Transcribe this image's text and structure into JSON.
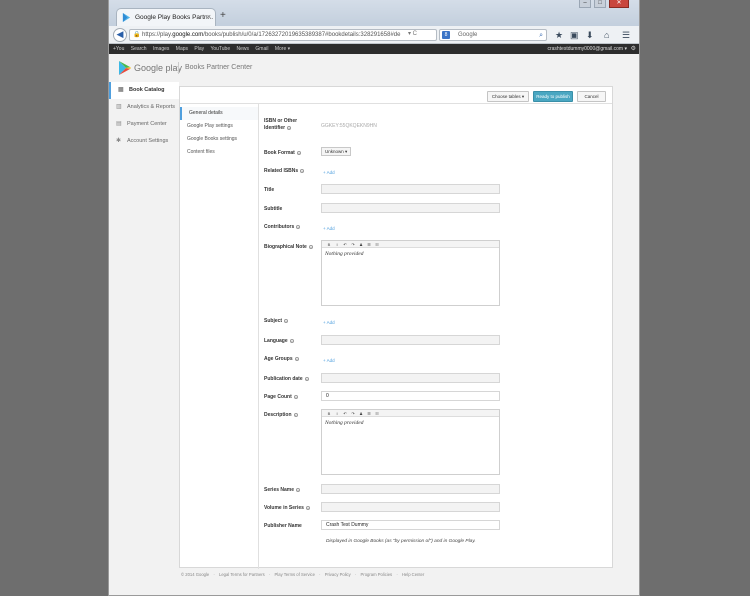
{
  "browser": {
    "tab_title": "Google Play Books Partn...",
    "tab_close": "×",
    "new_tab": "+",
    "url_prefix": "https://play.",
    "url_domain": "google.com",
    "url_rest": "/books/publish/u/0/a/17263272019635389387#bookdetails:328291658#de",
    "search_engine": "8",
    "search_placeholder": "Google",
    "window_min": "–",
    "window_max": "□",
    "window_close": "✕"
  },
  "google_bar": {
    "links": [
      "+You",
      "Search",
      "Images",
      "Maps",
      "Play",
      "YouTube",
      "News",
      "Gmail",
      "More ▾"
    ],
    "account": "crashtestdummy0000@gmail.com ▾"
  },
  "app": {
    "logo_text": "Google play",
    "partner_center": "Books Partner Center",
    "left_nav": [
      "Book Catalog",
      "Analytics & Reports",
      "Payment Center",
      "Account Settings"
    ],
    "toolbar": {
      "choose_tables": "Choose tables ▾",
      "ready": "Ready to publish",
      "cancel": "Cancel"
    },
    "sub_nav": [
      "General details",
      "Google Play settings",
      "Google Books settings",
      "Content files"
    ]
  },
  "form": {
    "isbn_label": "ISBN or Other Identifier",
    "isbn_value": "GGKEY:55QKQEKN9HN",
    "format_label": "Book Format",
    "format_value": "Unknown",
    "related_label": "Related ISBNs",
    "add": "+ Add",
    "title_label": "Title",
    "subtitle_label": "Subtitle",
    "contributors_label": "Contributors",
    "bio_label": "Biographical Note",
    "nothing_provided": "Nothing provided",
    "subject_label": "Subject",
    "language_label": "Language",
    "age_label": "Age Groups",
    "pubdate_label": "Publication date",
    "pagecount_label": "Page Count",
    "pagecount_value": "0",
    "description_label": "Description",
    "series_label": "Series Name",
    "volume_label": "Volume in Series",
    "publisher_label": "Publisher Name",
    "publisher_value": "Crash Test Dummy",
    "note": "Displayed in Google Books (as \"by permission of\") and in Google Play."
  },
  "footer": [
    "© 2014 Google",
    "·",
    "Legal Terms for Partners",
    "·",
    "Play Terms of Service",
    "·",
    "Privacy Policy",
    "·",
    "Program Policies",
    "·",
    "Help Center"
  ]
}
